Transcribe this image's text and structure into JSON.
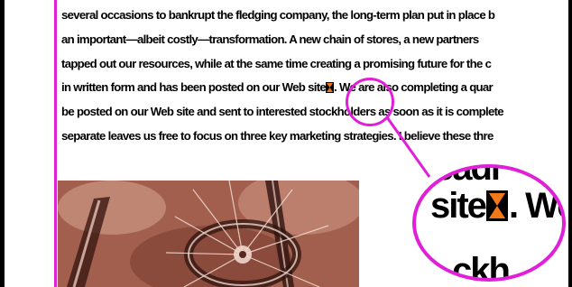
{
  "document": {
    "lines": [
      "several occasions to bankrupt the fledging company, the long-term plan put in place b",
      "an important—albeit costly—transformation. A new chain of stores, a new partners",
      "tapped out our resources, while at the same time creating a promising future for the c",
      "in written form and has been posted on our Web site",
      ". We are also completing a quar",
      "be posted on our Web site and sent to interested stockholders as soon as it is complete",
      "separate leaves us free to focus on three key marketing strategies. I believe these thre"
    ]
  },
  "magnifier": {
    "word_before": "site",
    "word_after": ". We",
    "top_fragment": "eadr",
    "bottom_fragment": "ckh"
  },
  "colors": {
    "frame_guide": "#e020d8",
    "marker_fill": "#f07818",
    "photo_tint": "#b06a57"
  },
  "icons": {
    "text_marker": "hourglass-marker-icon"
  }
}
